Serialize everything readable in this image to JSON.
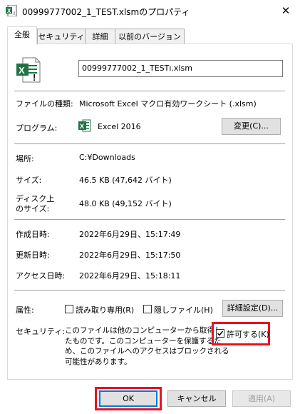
{
  "window": {
    "title": "00999777002_1_TEST.xlsmのプロパティ",
    "close_glyph": "✕"
  },
  "tabs": [
    {
      "label": "全般",
      "active": true
    },
    {
      "label": "セキュリティ",
      "active": false
    },
    {
      "label": "詳細",
      "active": false
    },
    {
      "label": "以前のバージョン",
      "active": false
    }
  ],
  "file": {
    "name": "00999777002_1_TESTı.xlsm",
    "type_label": "ファイルの種類:",
    "type_value": "Microsoft Excel マクロ有効ワークシート (.xlsm)",
    "program_label": "プログラム:",
    "program_value": "Excel 2016",
    "change_button": "変更(C)...",
    "location_label": "場所:",
    "location_value": "C:¥Downloads",
    "size_label": "サイズ:",
    "size_value": "46.5 KB (47,642 バイト)",
    "disk_size_label_1": "ディスク上",
    "disk_size_label_2": "のサイズ:",
    "disk_size_value": "48.0 KB (49,152 バイト)",
    "created_label": "作成日時:",
    "created_value": "2022年6月29日、15:17:49",
    "modified_label": "更新日時:",
    "modified_value": "2022年6月29日、15:17:50",
    "accessed_label": "アクセス日時:",
    "accessed_value": "2022年6月29日、15:18:11"
  },
  "attributes": {
    "label": "属性:",
    "readonly": "読み取り専用(R)",
    "hidden": "隠しファイル(H)",
    "advanced_button": "詳細設定(D)..."
  },
  "security": {
    "label": "セキュリティ:",
    "message_lines": [
      "このファイルは他のコンピューターから取得し",
      "たものです。このコンピューターを保護するた",
      "め、このファイルへのアクセスはブロックされる",
      "可能性があります。"
    ],
    "allow_label": "許可する(K)",
    "allow_checked": true
  },
  "footer": {
    "ok": "OK",
    "cancel": "キャンセル",
    "apply": "適用(A)"
  },
  "colors": {
    "highlight": "#e81123",
    "excel_green": "#217346"
  },
  "icons": {
    "title_icon": "excel-file-icon",
    "file_icon": "excel-macro-file-icon",
    "program_icon": "excel-icon"
  }
}
